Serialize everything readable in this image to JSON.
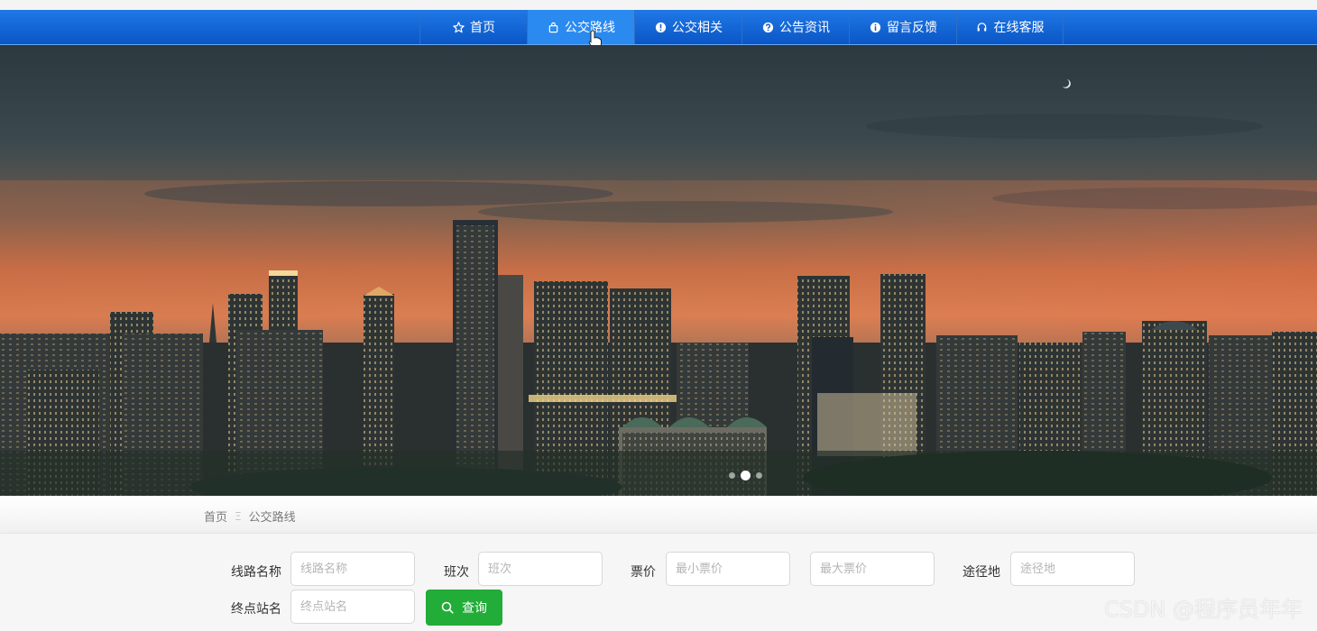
{
  "nav": {
    "items": [
      {
        "label": "首页",
        "icon": "star-icon",
        "active": false
      },
      {
        "label": "公交路线",
        "icon": "bag-icon",
        "active": true
      },
      {
        "label": "公交相关",
        "icon": "exclamation-circle-icon",
        "active": false
      },
      {
        "label": "公告资讯",
        "icon": "question-circle-icon",
        "active": false
      },
      {
        "label": "留言反馈",
        "icon": "info-circle-icon",
        "active": false
      },
      {
        "label": "在线客服",
        "icon": "headset-icon",
        "active": false
      }
    ]
  },
  "banner": {
    "carousel_dots": 3,
    "active_dot": 1
  },
  "breadcrumb": {
    "home": "首页",
    "separator": "Ξ",
    "current": "公交路线"
  },
  "search": {
    "route_name": {
      "label": "线路名称",
      "placeholder": "线路名称",
      "value": ""
    },
    "trips": {
      "label": "班次",
      "placeholder": "班次",
      "value": ""
    },
    "price": {
      "label": "票价",
      "min_placeholder": "最小票价",
      "max_placeholder": "最大票价"
    },
    "via": {
      "label": "途径地",
      "placeholder": "途径地",
      "value": ""
    },
    "terminal": {
      "label": "终点站名",
      "placeholder": "终点站名",
      "value": ""
    },
    "button": "查询"
  },
  "watermark": "CSDN @程序员年年",
  "colors": {
    "nav_blue": "#0b56c6",
    "nav_active": "#2a8af0",
    "search_button": "#22ac38"
  }
}
